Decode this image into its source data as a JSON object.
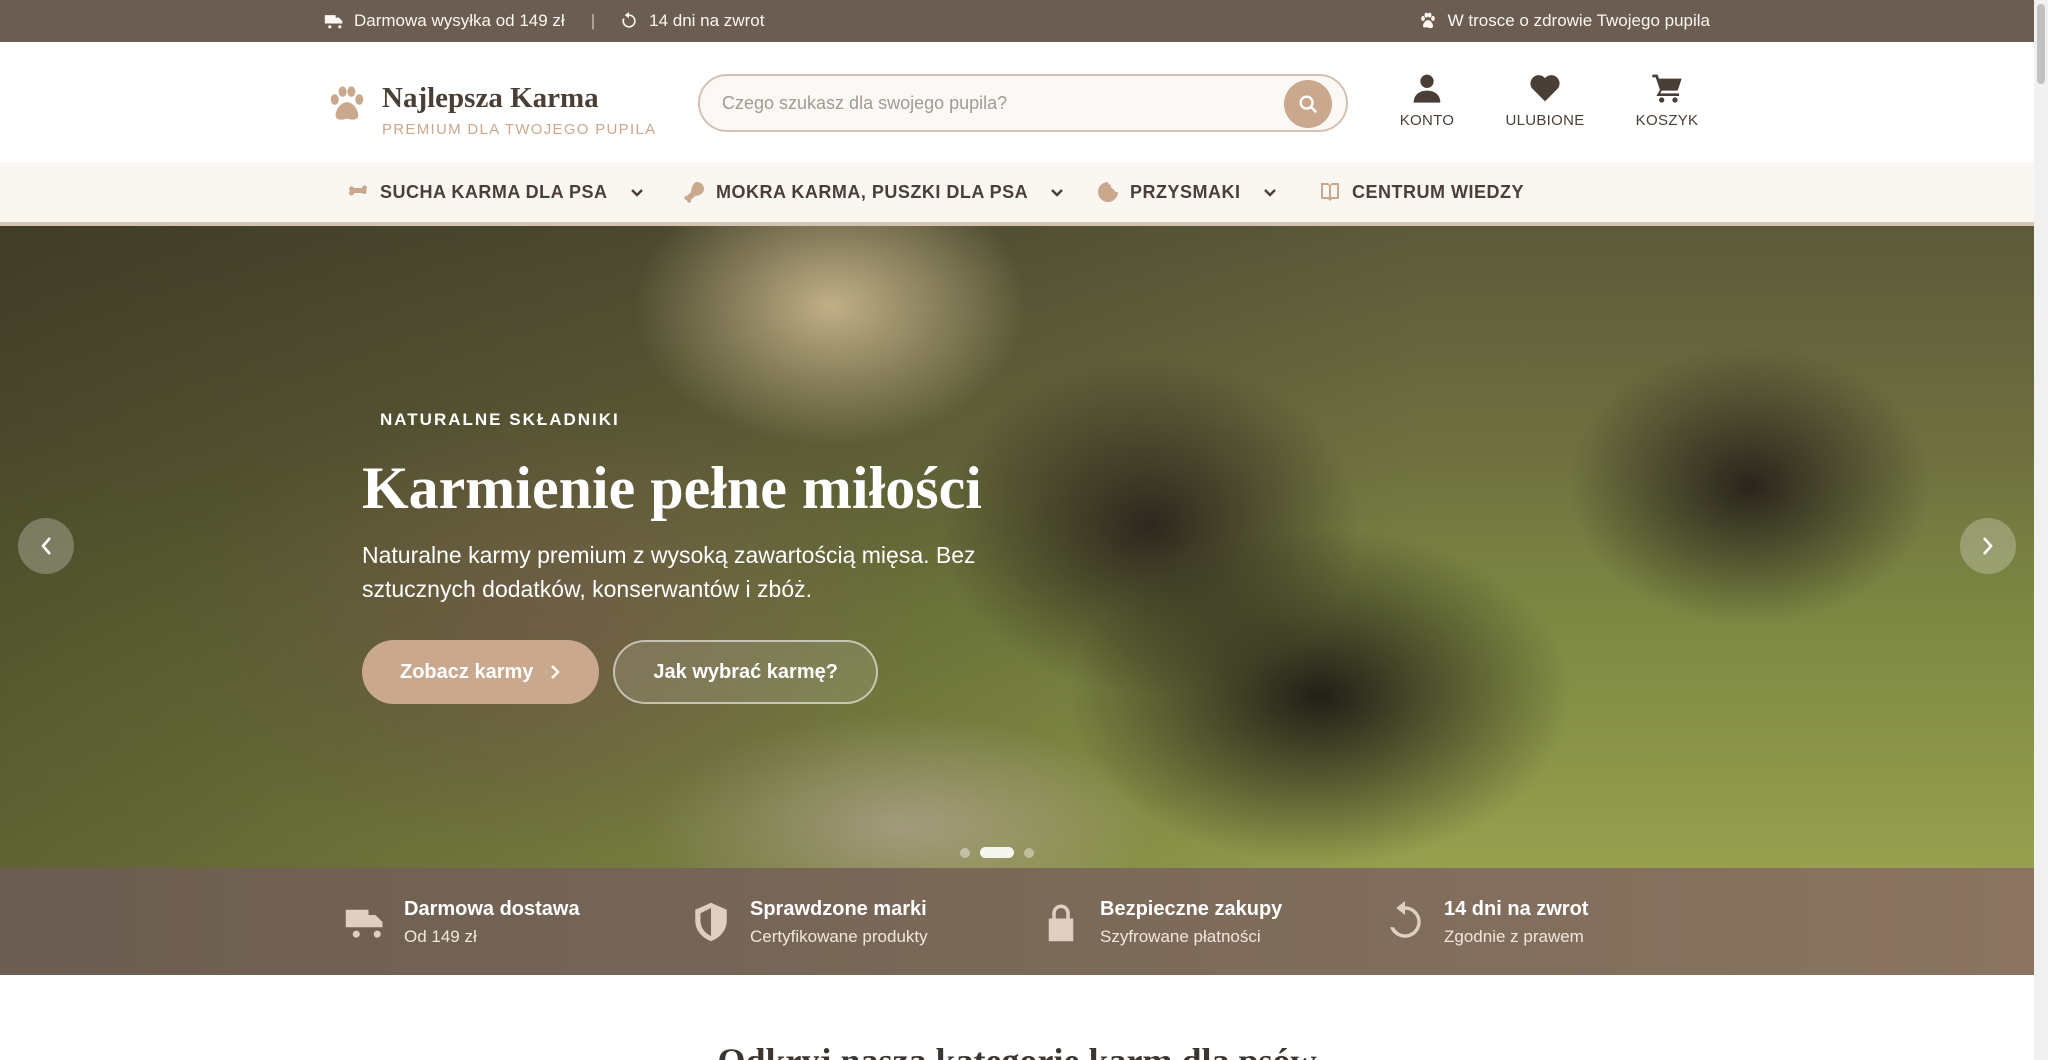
{
  "topbar": {
    "shipping": "Darmowa wysyłka od 149 zł",
    "separator": "|",
    "returns": "14 dni na zwrot",
    "care": "W trosce o zdrowie Twojego pupila"
  },
  "header": {
    "logo_name": "Najlepsza Karma",
    "logo_tagline": "PREMIUM DLA TWOJEGO PUPILA",
    "search_placeholder": "Czego szukasz dla swojego pupila?",
    "search_value": "",
    "account_label": "KONTO",
    "favorites_label": "ULUBIONE",
    "cart_label": "KOSZYK"
  },
  "nav": {
    "items": [
      {
        "label": "SUCHA KARMA DLA PSA",
        "icon": "bone-icon",
        "dropdown": true
      },
      {
        "label": "MOKRA KARMA, PUSZKI DLA PSA",
        "icon": "meat-icon",
        "dropdown": true
      },
      {
        "label": "PRZYSMAKI",
        "icon": "cookie-icon",
        "dropdown": true
      },
      {
        "label": "CENTRUM WIEDZY",
        "icon": "book-icon",
        "dropdown": false
      }
    ]
  },
  "hero": {
    "eyebrow": "NATURALNE SKŁADNIKI",
    "title": "Karmienie pełne miłości",
    "subtitle": "Naturalne karmy premium z wysoką zawartością mięsa. Bez sztucznych dodatków, konserwantów i zbóż.",
    "primary_cta": "Zobacz karmy",
    "secondary_cta": "Jak wybrać karmę?",
    "slides_count": 3,
    "active_slide": 2
  },
  "features": [
    {
      "title": "Darmowa dostawa",
      "subtitle": "Od 149 zł",
      "icon": "truck-icon"
    },
    {
      "title": "Sprawdzone marki",
      "subtitle": "Certyfikowane produkty",
      "icon": "shield-icon"
    },
    {
      "title": "Bezpieczne zakupy",
      "subtitle": "Szyfrowane płatności",
      "icon": "lock-icon"
    },
    {
      "title": "14 dni na zwrot",
      "subtitle": "Zgodnie z prawem",
      "icon": "return-icon"
    }
  ],
  "section": {
    "title": "Odkryj naszą kategorię karm dla psów"
  },
  "colors": {
    "accent": "#c9a88d",
    "topbar_bg": "#6b5d51",
    "text_dark": "#4a3f37"
  }
}
